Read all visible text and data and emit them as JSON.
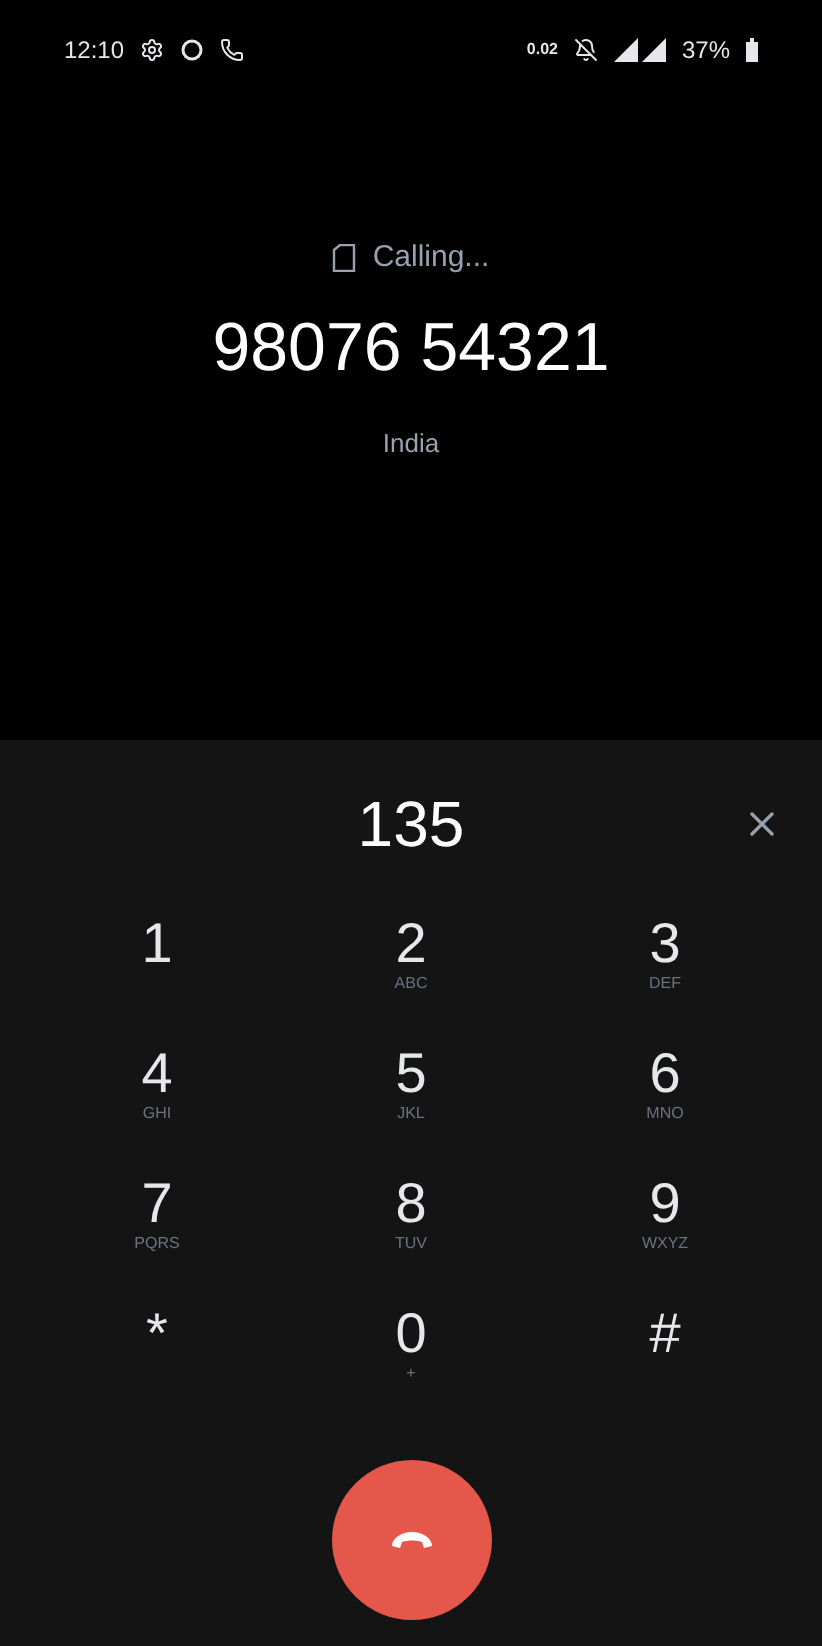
{
  "status_bar": {
    "time": "12:10",
    "data_speed": "0.02",
    "battery": "37%"
  },
  "call": {
    "status": "Calling...",
    "number": "98076 54321",
    "location": "India"
  },
  "dialpad": {
    "digits": "135",
    "keys": [
      {
        "digit": "1"
      },
      {
        "digit": "2",
        "letters": "ABC"
      },
      {
        "digit": "3",
        "letters": "DEF"
      },
      {
        "digit": "4",
        "letters": "GHI"
      },
      {
        "digit": "5",
        "letters": "JKL"
      },
      {
        "digit": "6",
        "letters": "MNO"
      },
      {
        "digit": "7",
        "letters": "PQRS"
      },
      {
        "digit": "8",
        "letters": "TUV"
      },
      {
        "digit": "9",
        "letters": "WXYZ"
      },
      {
        "digit": "*"
      },
      {
        "digit": "0",
        "letters": "+"
      },
      {
        "digit": "#"
      }
    ]
  }
}
